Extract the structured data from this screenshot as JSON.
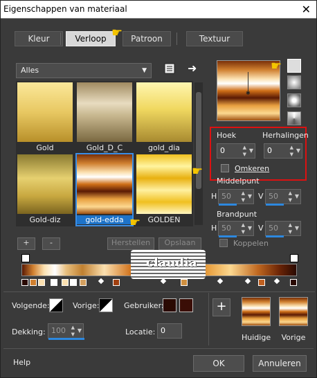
{
  "window": {
    "title": "Eigenschappen van materiaal",
    "close": "✕"
  },
  "tabs": [
    {
      "label": "Kleur"
    },
    {
      "label": "Verloop"
    },
    {
      "label": "Patroon"
    },
    {
      "label": "Textuur"
    }
  ],
  "library": {
    "dropdown_value": "Alles",
    "swatches": [
      {
        "label": "Gold"
      },
      {
        "label": "Gold_D_C"
      },
      {
        "label": "gold_dia"
      },
      {
        "label": "Gold-diz"
      },
      {
        "label": "gold-edda"
      },
      {
        "label": "GOLDEN"
      }
    ]
  },
  "angle": {
    "label": "Hoek",
    "value": "0"
  },
  "repeats": {
    "label": "Herhalingen",
    "value": "0"
  },
  "invert": {
    "label": "Omkeren"
  },
  "midpoint": {
    "label": "Middelpunt",
    "h_label": "H",
    "h_value": "50",
    "v_label": "V",
    "v_value": "50"
  },
  "focal": {
    "label": "Brandpunt",
    "h_label": "H",
    "h_value": "50",
    "v_label": "V",
    "v_value": "50"
  },
  "editor": {
    "add": "+",
    "remove": "-",
    "restore": "Herstellen",
    "save": "Opslaan",
    "link": "Koppelen"
  },
  "stops": {
    "next_label": "Volgende:",
    "prev_label": "Vorige:",
    "user_label": "Gebruiker:",
    "opacity_label": "Dekking:",
    "opacity_value": "100",
    "location_label": "Locatie:",
    "location_value": "0"
  },
  "previews": {
    "current": "Huidige",
    "previous": "Vorige"
  },
  "footer": {
    "help": "Help",
    "ok": "OK",
    "cancel": "Annuleren"
  },
  "watermark": {
    "text": "claudia"
  }
}
